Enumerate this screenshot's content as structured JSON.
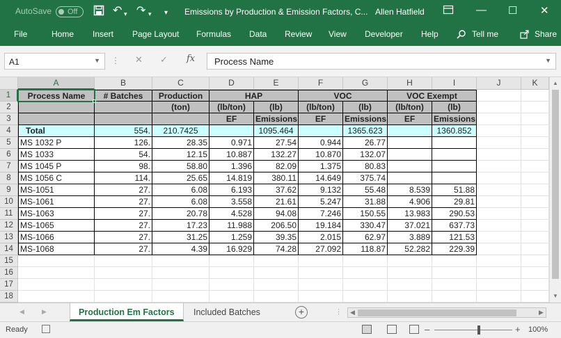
{
  "titlebar": {
    "autosave_label": "AutoSave",
    "autosave_state": "Off",
    "doc_title": "Emissions by Production & Emission Factors, C...",
    "user": "Allen Hatfield"
  },
  "ribbon_tabs": [
    "File",
    "Home",
    "Insert",
    "Page Layout",
    "Formulas",
    "Data",
    "Review",
    "View",
    "Developer",
    "Help"
  ],
  "tell_me": "Tell me",
  "share": "Share",
  "formula_bar": {
    "name_box": "A1",
    "formula": "Process Name"
  },
  "columns": [
    "A",
    "B",
    "C",
    "D",
    "E",
    "F",
    "G",
    "H",
    "I",
    "J",
    "K"
  ],
  "rows": [
    "1",
    "2",
    "3",
    "4",
    "5",
    "6",
    "7",
    "8",
    "9",
    "10",
    "11",
    "12",
    "13",
    "14",
    "15",
    "16",
    "17",
    "18"
  ],
  "headers": {
    "process_name": "Process Name",
    "batches": "# Batches",
    "production": "Production",
    "production_unit": "(ton)",
    "hap": "HAP",
    "voc": "VOC",
    "voc_exempt": "VOC Exempt",
    "lb_per_ton": "(lb/ton)",
    "lb": "(lb)",
    "ef": "EF",
    "emissions": "Emissions"
  },
  "total_row": {
    "label": "Total",
    "batches": "554.",
    "production": "210.7425",
    "hap_emissions": "1095.464",
    "voc_emissions": "1365.623",
    "vocx_emissions": "1360.852"
  },
  "data_rows": [
    {
      "name": "MS 1032 P",
      "batches": "126.",
      "production": "28.35",
      "hap_ef": "0.971",
      "hap_em": "27.54",
      "voc_ef": "0.944",
      "voc_em": "26.77",
      "vocx_ef": "",
      "vocx_em": ""
    },
    {
      "name": "MS 1033",
      "batches": "54.",
      "production": "12.15",
      "hap_ef": "10.887",
      "hap_em": "132.27",
      "voc_ef": "10.870",
      "voc_em": "132.07",
      "vocx_ef": "",
      "vocx_em": ""
    },
    {
      "name": "MS 1045 P",
      "batches": "98.",
      "production": "58.80",
      "hap_ef": "1.396",
      "hap_em": "82.09",
      "voc_ef": "1.375",
      "voc_em": "80.83",
      "vocx_ef": "",
      "vocx_em": ""
    },
    {
      "name": "MS 1056 C",
      "batches": "114.",
      "production": "25.65",
      "hap_ef": "14.819",
      "hap_em": "380.11",
      "voc_ef": "14.649",
      "voc_em": "375.74",
      "vocx_ef": "",
      "vocx_em": ""
    },
    {
      "name": "MS-1051",
      "batches": "27.",
      "production": "6.08",
      "hap_ef": "6.193",
      "hap_em": "37.62",
      "voc_ef": "9.132",
      "voc_em": "55.48",
      "vocx_ef": "8.539",
      "vocx_em": "51.88"
    },
    {
      "name": "MS-1061",
      "batches": "27.",
      "production": "6.08",
      "hap_ef": "3.558",
      "hap_em": "21.61",
      "voc_ef": "5.247",
      "voc_em": "31.88",
      "vocx_ef": "4.906",
      "vocx_em": "29.81"
    },
    {
      "name": "MS-1063",
      "batches": "27.",
      "production": "20.78",
      "hap_ef": "4.528",
      "hap_em": "94.08",
      "voc_ef": "7.246",
      "voc_em": "150.55",
      "vocx_ef": "13.983",
      "vocx_em": "290.53"
    },
    {
      "name": "MS-1065",
      "batches": "27.",
      "production": "17.23",
      "hap_ef": "11.988",
      "hap_em": "206.50",
      "voc_ef": "19.184",
      "voc_em": "330.47",
      "vocx_ef": "37.021",
      "vocx_em": "637.73"
    },
    {
      "name": "MS-1066",
      "batches": "27.",
      "production": "31.25",
      "hap_ef": "1.259",
      "hap_em": "39.35",
      "voc_ef": "2.015",
      "voc_em": "62.97",
      "vocx_ef": "3.889",
      "vocx_em": "121.53"
    },
    {
      "name": "MS-1068",
      "batches": "27.",
      "production": "4.39",
      "hap_ef": "16.929",
      "hap_em": "74.28",
      "voc_ef": "27.092",
      "voc_em": "118.87",
      "vocx_ef": "52.282",
      "vocx_em": "229.39"
    }
  ],
  "sheets": [
    "Production Em Factors",
    "Included Batches"
  ],
  "status": {
    "ready": "Ready",
    "zoom": "100%"
  },
  "colors": {
    "accent": "#217346",
    "header_fill": "#c0c0c0",
    "total_fill": "#ccffff"
  }
}
